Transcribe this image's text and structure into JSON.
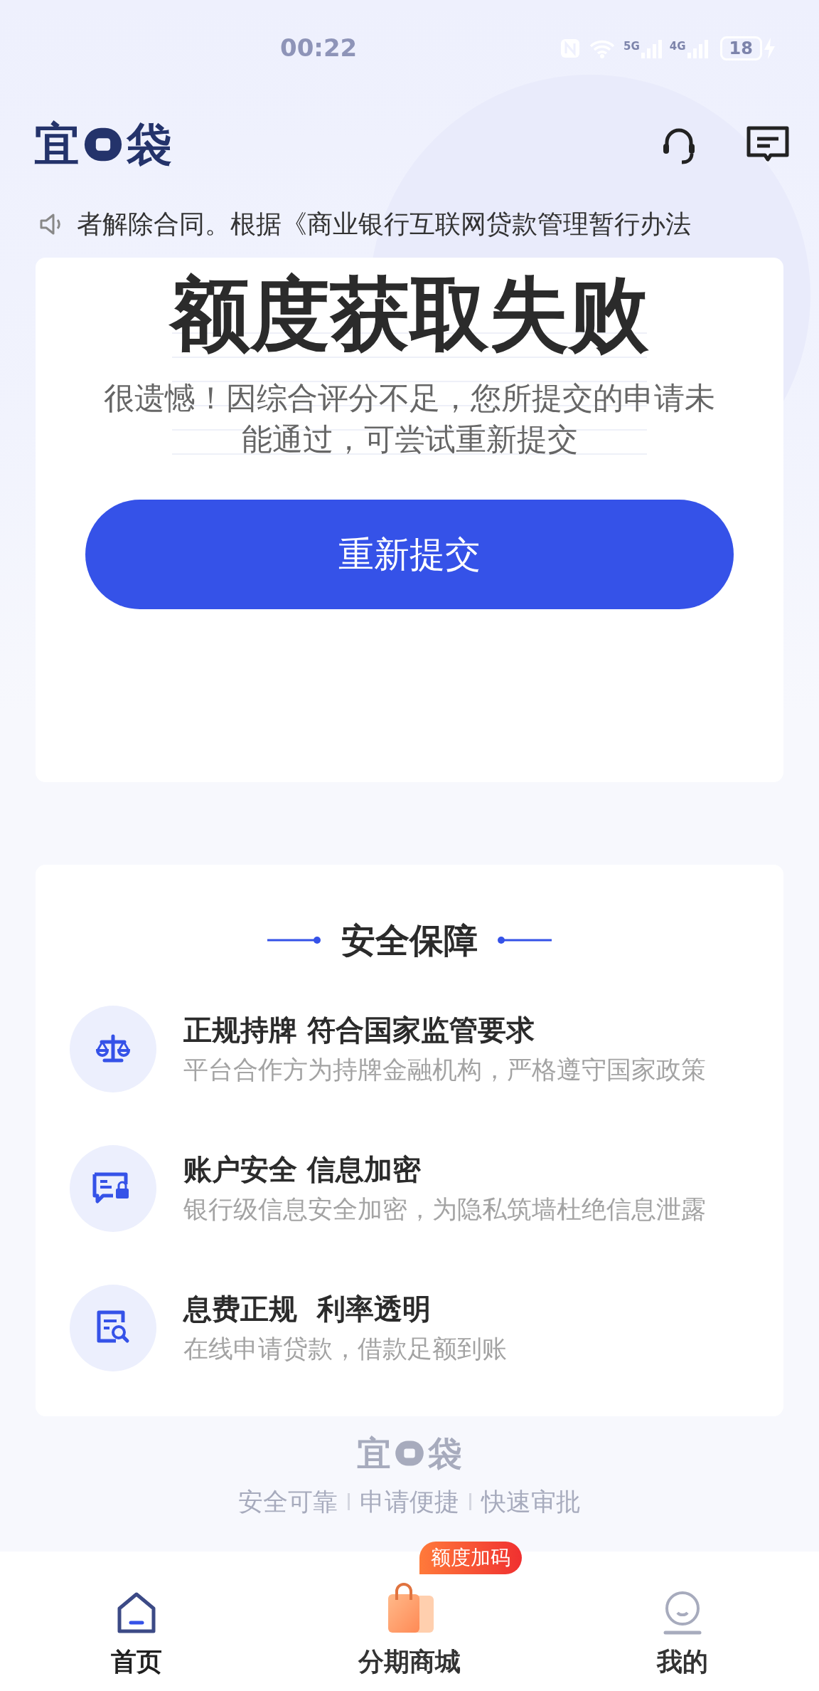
{
  "status_bar": {
    "time": "00:22",
    "network_1": "5G",
    "network_2": "4G",
    "battery": "18"
  },
  "header": {
    "logo": {
      "left": "宜",
      "right": "袋"
    }
  },
  "notice": {
    "text": "者解除合同。根据《商业银行互联网贷款管理暂行办法"
  },
  "result_card": {
    "title": "额度获取失败",
    "description": "很遗憾！因综合评分不足，您所提交的申请未能通过，可尝试重新提交",
    "button": "重新提交"
  },
  "security": {
    "title": "安全保障",
    "items": [
      {
        "kind": "scale",
        "title": "正规持牌 符合国家监管要求",
        "subtitle": "平台合作方为持牌金融机构，严格遵守国家政策"
      },
      {
        "kind": "lock",
        "title": "账户安全 信息加密",
        "subtitle": "银行级信息安全加密，为隐私筑墙杜绝信息泄露"
      },
      {
        "kind": "search",
        "title": "息费正规  利率透明",
        "subtitle": "在线申请贷款，借款足额到账"
      }
    ]
  },
  "footer": {
    "logo": {
      "left": "宜",
      "right": "袋"
    },
    "tags": [
      "安全可靠",
      "申请便捷",
      "快速审批"
    ]
  },
  "tab_bar": [
    {
      "kind": "home",
      "label": "首页",
      "selected": true
    },
    {
      "kind": "shop",
      "label": "分期商城",
      "selected": false,
      "badge": "额度加码"
    },
    {
      "kind": "me",
      "label": "我的",
      "selected": false
    }
  ]
}
